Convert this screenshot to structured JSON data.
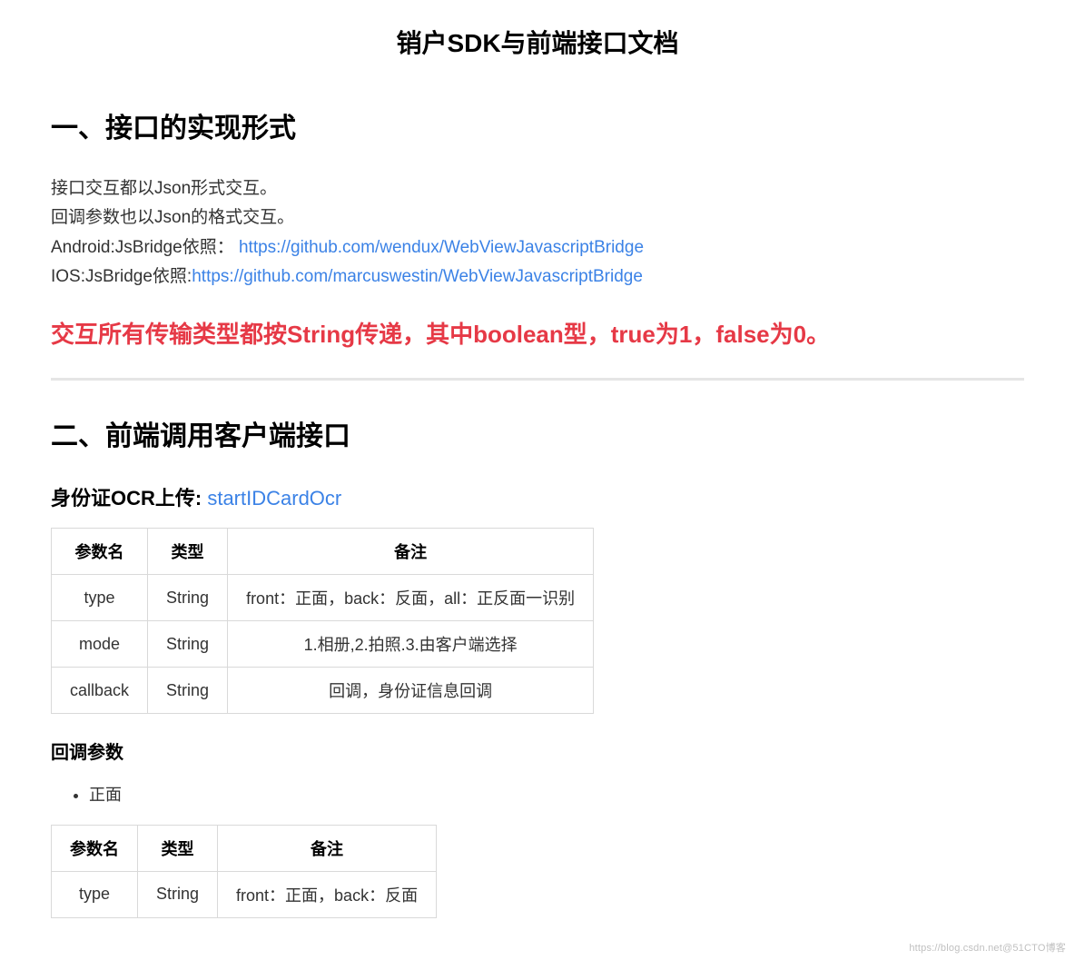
{
  "title": "销户SDK与前端接口文档",
  "section1": {
    "heading": "一、接口的实现形式",
    "lines": {
      "l1": "接口交互都以Json形式交互。",
      "l2": "回调参数也以Json的格式交互。",
      "l3_prefix": "Android:JsBridge依照：",
      "l3_link": "https://github.com/wendux/WebViewJavascriptBridge",
      "l4_prefix": "IOS:JsBridge依照:",
      "l4_link": "https://github.com/marcuswestin/WebViewJavascriptBridge"
    },
    "warning": "交互所有传输类型都按String传递，其中boolean型，true为1，false为0。"
  },
  "section2": {
    "heading": "二、前端调用客户端接口",
    "sub1": {
      "label_prefix": "身份证OCR上传: ",
      "method": "startIDCardOcr",
      "table1": {
        "headers": [
          "参数名",
          "类型",
          "备注"
        ],
        "rows": [
          [
            "type",
            "String",
            "front：正面，back：反面，all：正反面一识别"
          ],
          [
            "mode",
            "String",
            "1.相册,2.拍照.3.由客户端选择"
          ],
          [
            "callback",
            "String",
            "回调，身份证信息回调"
          ]
        ]
      },
      "callback_heading": "回调参数",
      "bullet1": "正面",
      "table2": {
        "headers": [
          "参数名",
          "类型",
          "备注"
        ],
        "rows": [
          [
            "type",
            "String",
            "front：正面，back：反面"
          ]
        ]
      }
    }
  },
  "watermark": "https://blog.csdn.net@51CTO博客"
}
